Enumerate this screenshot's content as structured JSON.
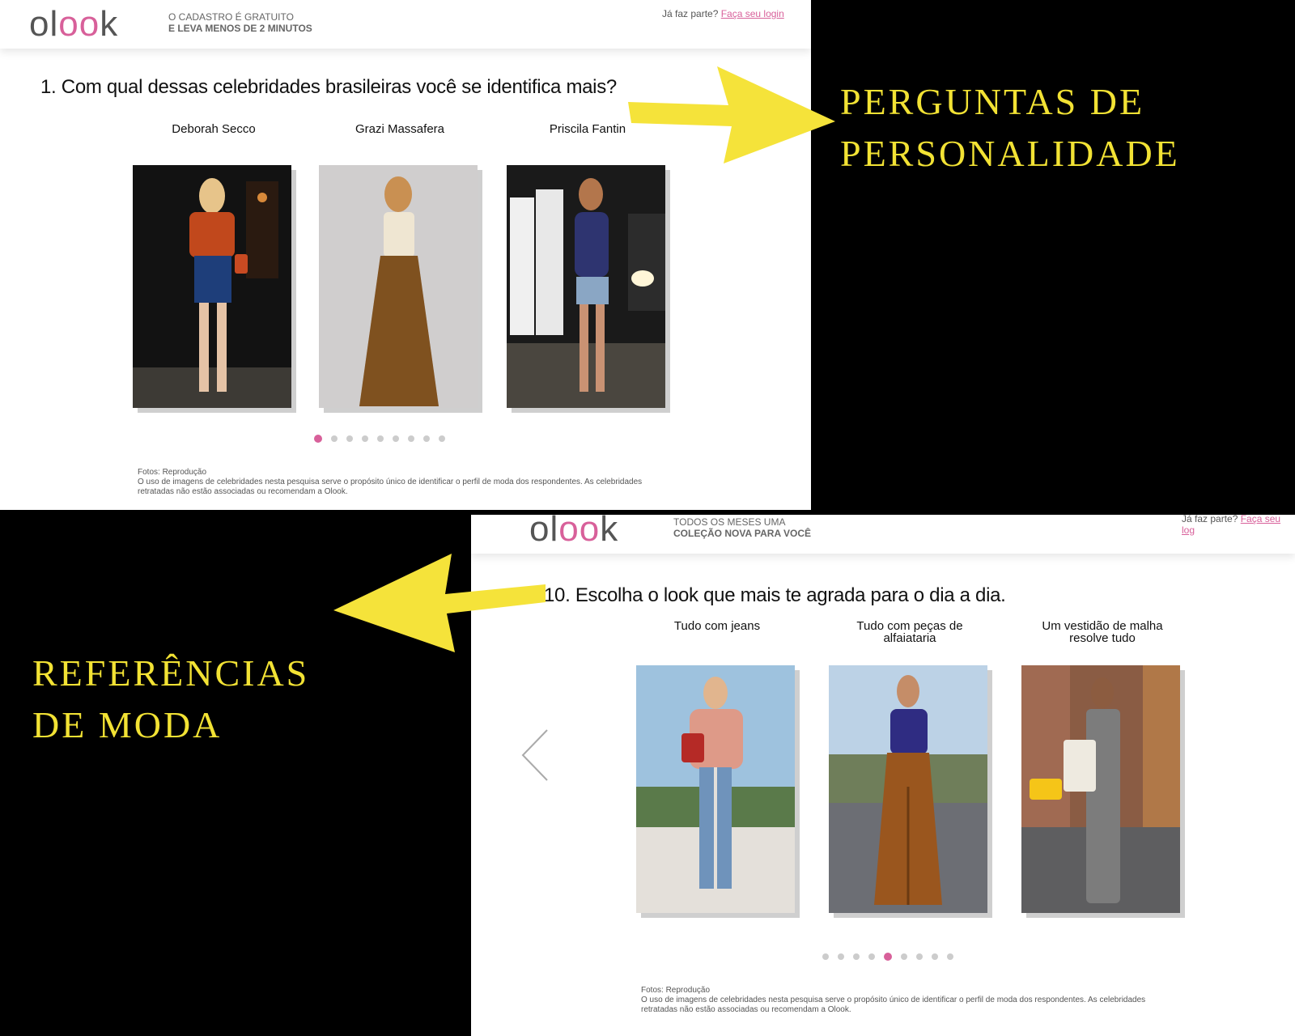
{
  "colors": {
    "accent": "#d8609a",
    "caption": "#f2e234",
    "arrow": "#f5e33a"
  },
  "annotations": {
    "top_caption": [
      "PERGUNTAS DE",
      "PERSONALIDADE"
    ],
    "bottom_caption": [
      "REFERÊNCIAS",
      "DE MODA"
    ]
  },
  "screen1": {
    "logo": {
      "prefix": "ol",
      "oo": "oo",
      "suffix": "k"
    },
    "tagline": [
      "O CADASTRO É GRATUITO",
      "E LEVA MENOS DE 2 MINUTOS"
    ],
    "login_prompt": "Já faz parte?",
    "login_link": "Faça seu login",
    "question": "1. Com qual dessas celebridades brasileiras você se identifica mais?",
    "options": [
      "Deborah Secco",
      "Grazi Massafera",
      "Priscila Fantin"
    ],
    "pagination": {
      "total": 9,
      "active": 1
    },
    "footnote": [
      "Fotos: Reprodução",
      "O uso de imagens de celebridades nesta pesquisa serve o propósito único de identificar o perfil de moda dos respondentes. As celebridades retratadas não estão associadas ou recomendam a Olook."
    ]
  },
  "screen2": {
    "logo": {
      "prefix": "ol",
      "oo": "oo",
      "suffix": "k"
    },
    "tagline": [
      "TODOS OS MESES UMA",
      "COLEÇÃO NOVA PARA VOCÊ"
    ],
    "login_prompt": "Já faz parte?",
    "login_link": "Faça seu log",
    "question": "10. Escolha o look que mais te agrada para o dia a dia.",
    "options": [
      "Tudo com jeans",
      "Tudo com peças de alfaiataria",
      "Um vestidão de malha resolve tudo"
    ],
    "pagination": {
      "total": 9,
      "active": 5
    },
    "footnote": [
      "Fotos: Reprodução",
      "O uso de imagens de celebridades nesta pesquisa serve o propósito único de identificar o perfil de moda dos respondentes. As celebridades retratadas não estão associadas ou recomendam a Olook."
    ]
  }
}
